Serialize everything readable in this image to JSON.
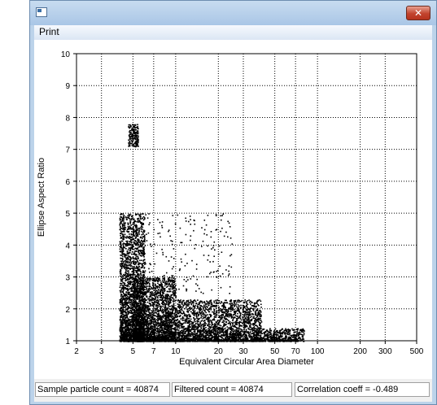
{
  "window": {
    "title": ""
  },
  "icons": {
    "app": "app-icon",
    "close": "close-icon"
  },
  "titlebar": {
    "close_glyph": "✕"
  },
  "menu": {
    "items": [
      "Print"
    ]
  },
  "status": {
    "sample": "Sample particle count = 40874",
    "filtered": "Filtered count = 40874",
    "correlation": "Correlation coeff = -0.489"
  },
  "colors": {
    "titlebar": "#bcd3ea",
    "close": "#c2442e",
    "points": "#000000",
    "grid": "#000000"
  },
  "chart_data": {
    "type": "scatter",
    "title": "",
    "xlabel": "Equivalent Circular Area Diameter",
    "ylabel": "Ellipse Aspect Ratio",
    "xscale": "log",
    "xlim": [
      2,
      500
    ],
    "ylim": [
      1,
      10
    ],
    "xticks": [
      2,
      3,
      5,
      7,
      10,
      20,
      30,
      50,
      70,
      100,
      200,
      300,
      500
    ],
    "yticks": [
      1,
      2,
      3,
      4,
      5,
      6,
      7,
      8,
      9,
      10
    ],
    "grid": true,
    "legend": "none",
    "point_count": 40874,
    "correlation": -0.489,
    "clusters": [
      {
        "x_range": [
          4.0,
          6.0
        ],
        "y_range": [
          1.0,
          5.0
        ],
        "density": "high"
      },
      {
        "x_range": [
          5.0,
          10.0
        ],
        "y_range": [
          1.0,
          3.0
        ],
        "density": "high"
      },
      {
        "x_range": [
          10.0,
          40.0
        ],
        "y_range": [
          1.0,
          2.3
        ],
        "density": "high"
      },
      {
        "x_range": [
          40.0,
          80.0
        ],
        "y_range": [
          1.0,
          1.4
        ],
        "density": "medium"
      },
      {
        "x_range": [
          6.0,
          25.0
        ],
        "y_range": [
          2.5,
          5.0
        ],
        "density": "sparse"
      },
      {
        "x_range": [
          4.6,
          5.4
        ],
        "y_range": [
          7.1,
          7.8
        ],
        "density": "sparse"
      }
    ]
  }
}
